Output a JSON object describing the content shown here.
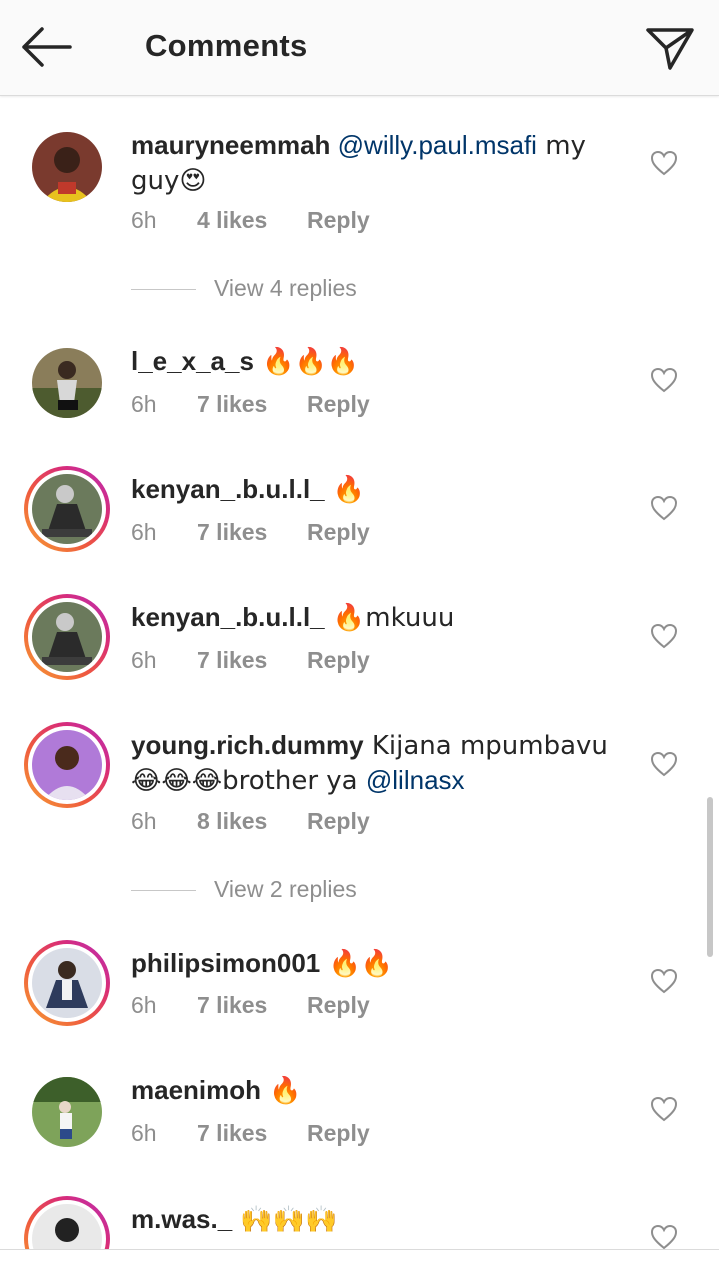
{
  "header": {
    "title": "Comments",
    "back_icon": "arrow-left-icon",
    "send_icon": "paper-plane-icon"
  },
  "comments": [
    {
      "user": "mauryneemmah",
      "mention": "@willy.paul.msafi",
      "text_after": " my guy😍",
      "time": "6h",
      "likes": "4 likes",
      "reply": "Reply",
      "view_replies": "View 4 replies"
    },
    {
      "user": "l_e_x_a_s",
      "text": " 🔥🔥🔥",
      "time": "6h",
      "likes": "7 likes",
      "reply": "Reply"
    },
    {
      "user": "kenyan_.b.u.l.l_",
      "text": " 🔥",
      "time": "6h",
      "likes": "7 likes",
      "reply": "Reply"
    },
    {
      "user": "kenyan_.b.u.l.l_",
      "text": " 🔥mkuuu",
      "time": "6h",
      "likes": "7 likes",
      "reply": "Reply"
    },
    {
      "user": "young.rich.dummy",
      "text": " Kijana mpumbavu 😂😂😂brother ya ",
      "mention": "@lilnasx",
      "time": "6h",
      "likes": "8 likes",
      "reply": "Reply",
      "view_replies": "View 2 replies"
    },
    {
      "user": "philipsimon001",
      "text": " 🔥🔥",
      "time": "6h",
      "likes": "7 likes",
      "reply": "Reply"
    },
    {
      "user": "maenimoh",
      "text": " 🔥",
      "time": "6h",
      "likes": "7 likes",
      "reply": "Reply"
    },
    {
      "user": "m.was._",
      "text": " 🙌🙌🙌"
    }
  ],
  "colors": {
    "mention": "#003569",
    "meta": "#8e8e8e",
    "story_ring": "#d92d77"
  }
}
